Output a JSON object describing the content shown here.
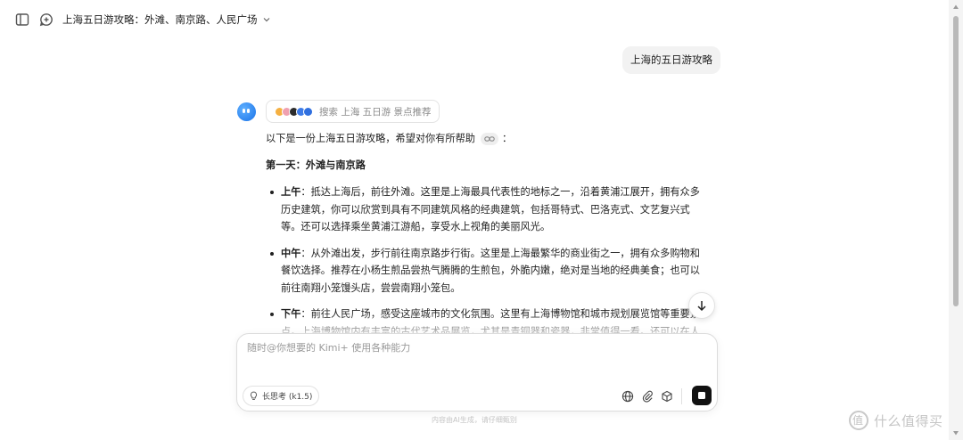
{
  "header": {
    "chat_title": "上海五日游攻略：外滩、南京路、人民广场"
  },
  "user_message": "上海的五日游攻略",
  "search_chip": {
    "label": "搜索 上海 五日游 景点推荐",
    "favicon_colors": [
      "#f5b041",
      "#f0a0b0",
      "#2c2c2c",
      "#3d7be8",
      "#2f6fdf"
    ]
  },
  "answer": {
    "intro": "以下是一份上海五日游攻略，希望对你有所帮助",
    "intro_suffix": "：",
    "day1_heading": "第一天：外滩与南京路",
    "items": [
      {
        "label": "上午",
        "text": "：抵达上海后，前往外滩。这里是上海最具代表性的地标之一，沿着黄浦江展开，拥有众多历史建筑，你可以欣赏到具有不同建筑风格的经典建筑，包括哥特式、巴洛克式、文艺复兴式等。还可以选择乘坐黄浦江游船，享受水上视角的美丽风光。"
      },
      {
        "label": "中午",
        "text": "：从外滩出发，步行前往南京路步行街。这里是上海最繁华的商业街之一，拥有众多购物和餐饮选择。推荐在小杨生煎品尝热气腾腾的生煎包，外脆内嫩，绝对是当地的经典美食；也可以前往南翔小笼馒头店，尝尝南翔小笼包。"
      },
      {
        "label": "下午",
        "text": "：前往人民广场，感受这座城市的文化氛围。这里有上海博物馆和城市规划展览馆等重要景点。上海博物馆内有丰富的古代艺术品展览，尤其是青铜器和瓷器，非常值得一看。还可以在人民广场上散步，放松心情。"
      }
    ]
  },
  "composer": {
    "placeholder": "随时@你想要的 Kimi+ 使用各种能力",
    "thinking_mode_label": "长思考 (k1.5)"
  },
  "disclaimer": "内容由AI生成，请仔细甄别",
  "watermark": {
    "text": "什么值得买"
  }
}
